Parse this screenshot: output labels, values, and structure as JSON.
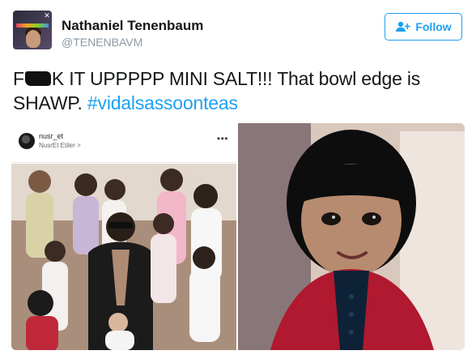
{
  "tweet": {
    "author_name": "Nathaniel Tenenbaum",
    "author_handle": "@TENENBAVM",
    "follow_label": "Follow",
    "text_part1": "F",
    "text_part2": "K IT UPPPPP MINI SALT!!! That bowl edge is SHAWP.",
    "hashtag": "#vidalsassoonteas"
  },
  "media": {
    "left_image": {
      "instagram_user": "nusr_et",
      "instagram_subtitle": "NusrEt Etiler >",
      "more_icon": "more-dots-icon"
    },
    "right_image": {}
  },
  "colors": {
    "accent": "#1da1f2",
    "text": "#14171a",
    "muted": "#8899a6"
  },
  "icons": {
    "follow": "add-person-icon"
  }
}
